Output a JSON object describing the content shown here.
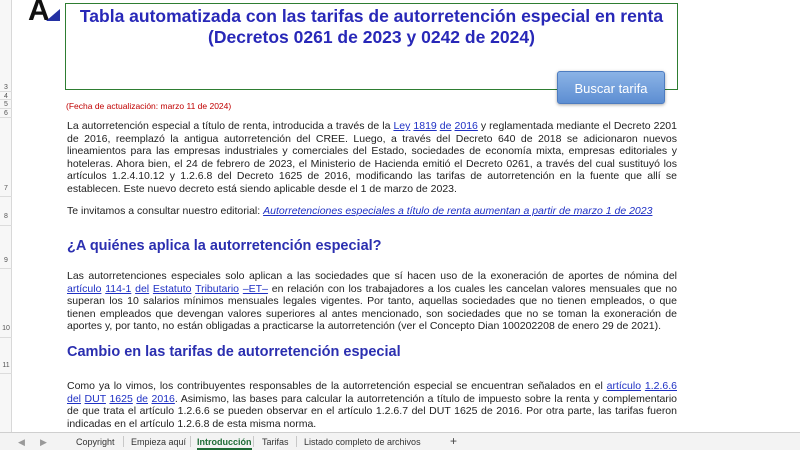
{
  "row_numbers": {
    "r3": "3",
    "r4": "4",
    "r5": "5",
    "r6": "6",
    "r7": "7",
    "r8": "8",
    "r9": "9",
    "r10": "10",
    "r11": "11"
  },
  "logo": {
    "letter": "A"
  },
  "header": {
    "title_line1": "Tabla automatizada con las tarifas de autorretención especial en renta",
    "title_line2": "(Decretos 0261 de 2023 y 0242 de 2024)",
    "search_button_label": "Buscar tarifa"
  },
  "update_date": "(Fecha de actualización: marzo 11 de 2024)",
  "para1": {
    "t1": "La autorretención especial a título de renta, introducida a través de la ",
    "link_ley": "Ley",
    "t2": " ",
    "link_1819": "1819",
    "t3": " ",
    "link_de": "de",
    "t4": " ",
    "link_2016": "2016",
    "t5": " y reglamentada mediante el Decreto 2201 de 2016, reemplazó la antigua autorretención del CREE. Luego, a través del Decreto 640 de 2018 se adicionaron nuevos lineamientos para las empresas industriales y comerciales del Estado, sociedades de economía mixta, empresas editoriales y hoteleras. Ahora bien, el 24 de febrero de 2023, el Ministerio de Hacienda emitió el Decreto 0261, a través del cual sustituyó los artículos 1.2.4.10.12 y 1.2.6.8 del Decreto 1625 de 2016, modificando las tarifas de autorretención en la fuente que allí se establecen. Este nuevo decreto está siendo aplicable desde el 1 de marzo de 2023."
  },
  "para2": {
    "t1": "Te invitamos a consultar nuestro editorial: ",
    "link": "Autorretenciones especiales a título de renta aumentan a partir de marzo 1 de 2023"
  },
  "heading1": "¿A quiénes aplica la autorretención especial?",
  "para3": {
    "t1": "Las autorretenciones especiales solo aplican a las sociedades que sí hacen uso de la exoneración de aportes de nómina del ",
    "link_articulo": "artículo",
    "t2": " ",
    "link_114": "114-1",
    "t3": " ",
    "link_del": "del",
    "t4": " ",
    "link_estatuto": "Estatuto",
    "t5": " ",
    "link_tributario": "Tributario",
    "t6": " ",
    "link_et": "–ET–",
    "t7": " en relación con los trabajadores a los cuales les cancelan valores mensuales que no superan los 10 salarios mínimos mensuales legales vigentes. Por tanto, aquellas sociedades que no tienen empleados, o que tienen empleados que devengan valores superiores al antes mencionado, son sociedades que no se toman la exoneración de aportes y, por tanto, no están obligadas a practicarse la autorretención (ver el Concepto Dian 100202208 de enero 29 de 2021)."
  },
  "heading2": "Cambio en las tarifas de autorretención especial",
  "para4": {
    "t1": "Como ya lo vimos, los contribuyentes responsables de la autorretención especial se encuentran señalados en el ",
    "link_articulo": "artículo",
    "t2": " ",
    "link_1266": "1.2.6.6",
    "t3": " ",
    "link_del": "del",
    "t4": " ",
    "link_dut": "DUT",
    "t5": " ",
    "link_1625": "1625",
    "t6": " ",
    "link_de": "de",
    "t7": " ",
    "link_2016": "2016",
    "t8": ". Asimismo, las bases para calcular la autorretención a título de impuesto sobre la renta y complementario de que trata el artículo 1.2.6.6 se pueden observar en el artículo 1.2.6.7 del DUT 1625 de 2016. Por otra parte, las tarifas fueron indicadas en el artículo 1.2.6.8 de esta misma norma."
  },
  "sheet_tabs": {
    "nav_prev": "◀",
    "nav_next": "▶",
    "copyright": "Copyright",
    "empieza": "Empieza aquí",
    "introduccion": "Introducción",
    "tarifas": "Tarifas",
    "listado": "Listado completo de archivos",
    "add": "+",
    "more": "⋮"
  },
  "colors": {
    "title": "#2828b8",
    "heading": "#2b2fb0",
    "link": "#1f30c4",
    "date": "#c00000",
    "active_tab": "#1e6b35",
    "button": "#6f9cd9"
  }
}
